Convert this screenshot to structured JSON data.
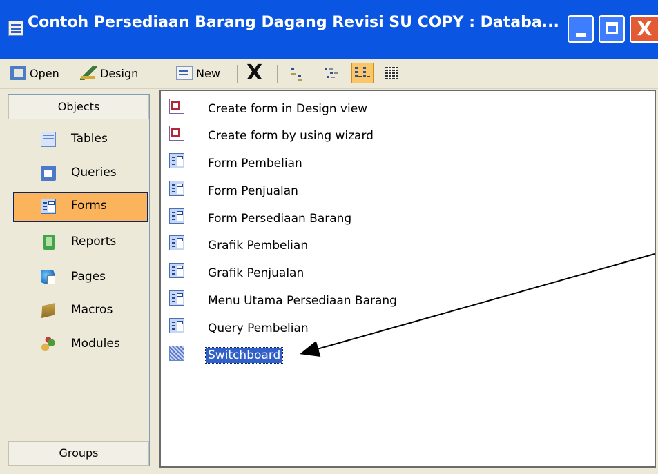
{
  "window": {
    "title": "Contoh Persediaan Barang Dagang Revisi SU COPY : Databa...",
    "close_glyph": "X"
  },
  "toolbar": {
    "open_label": "Open",
    "design_label": "Design",
    "new_label": "New",
    "delete_glyph": "X"
  },
  "objects_bar": {
    "header": "Objects",
    "items": [
      {
        "label": "Tables",
        "icon": "table-icon"
      },
      {
        "label": "Queries",
        "icon": "query-icon"
      },
      {
        "label": "Forms",
        "icon": "form-icon",
        "selected": true
      },
      {
        "label": "Reports",
        "icon": "report-icon"
      },
      {
        "label": "Pages",
        "icon": "page-icon"
      },
      {
        "label": "Macros",
        "icon": "macro-icon"
      },
      {
        "label": "Modules",
        "icon": "module-icon"
      }
    ],
    "groups_label": "Groups"
  },
  "form_list": {
    "items": [
      {
        "label": "Create form in Design view",
        "icon": "wizard-icon"
      },
      {
        "label": "Create form by using wizard",
        "icon": "wizard-icon"
      },
      {
        "label": "Form Pembelian",
        "icon": "form-icon"
      },
      {
        "label": "Form Penjualan",
        "icon": "form-icon"
      },
      {
        "label": "Form Persediaan Barang",
        "icon": "form-icon"
      },
      {
        "label": "Grafik Pembelian",
        "icon": "form-icon"
      },
      {
        "label": "Grafik Penjualan",
        "icon": "form-icon"
      },
      {
        "label": "Menu Utama Persediaan Barang",
        "icon": "form-icon"
      },
      {
        "label": "Query Pembelian",
        "icon": "form-icon"
      },
      {
        "label": "Switchboard",
        "icon": "switchboard-icon",
        "selected": true
      }
    ]
  },
  "colors": {
    "titlebar": "#0b55e3",
    "selection": "#3160c8",
    "objects_selected": "#fbb45c",
    "panel": "#ece9d8"
  }
}
